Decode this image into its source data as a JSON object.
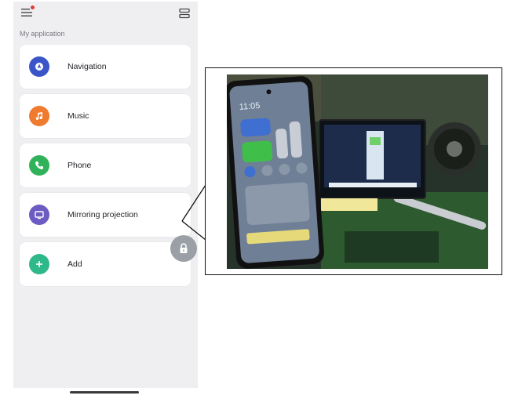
{
  "header": {
    "menu_icon": "menu-icon",
    "notification_color": "#e53935",
    "cast_icon": "screen-cast-icon"
  },
  "section_label": "My application",
  "apps": [
    {
      "label": "Navigation",
      "icon": "navigation-icon",
      "color": "#3a55c8"
    },
    {
      "label": "Music",
      "icon": "music-note-icon",
      "color": "#f07a2e"
    },
    {
      "label": "Phone",
      "icon": "phone-icon",
      "color": "#2fb25a"
    },
    {
      "label": "Mirroring projection",
      "icon": "mirroring-icon",
      "color": "#6c5bc2"
    },
    {
      "label": "Add",
      "icon": "add-icon",
      "color": "#2fb88a"
    }
  ],
  "floating_button": {
    "icon": "lock-icon",
    "color": "#9aa0a6"
  },
  "photo": {
    "description_icon": "phone-mirroring-photo",
    "phone_time": "11:05"
  }
}
